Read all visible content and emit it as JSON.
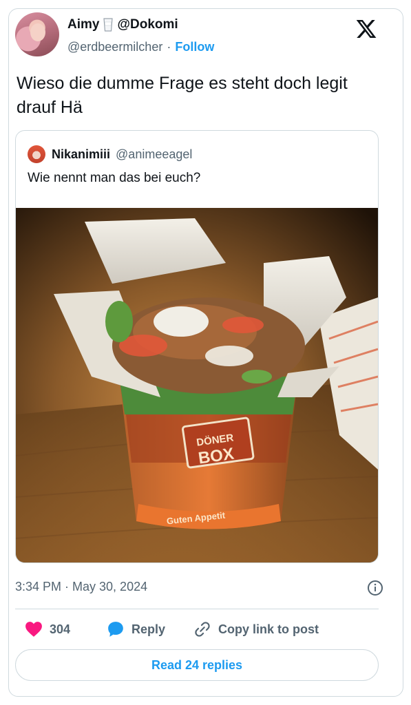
{
  "author": {
    "display_name": "Aimy",
    "name_suffix": "@Dokomi",
    "handle": "@erdbeermilcher",
    "separator": "·",
    "follow_label": "Follow"
  },
  "tweet": {
    "text": "Wieso die dumme Frage es steht doch legit drauf Hä",
    "timestamp": "3:34 PM · May 30, 2024"
  },
  "quote": {
    "display_name": "Nikanimiii",
    "handle": "@animeeagel",
    "text": "Wie nennt man das bei euch?",
    "image": {
      "box_brand_line1": "DÖNER",
      "box_brand_line2": "BOX",
      "box_slogan": "Guten Appetit"
    }
  },
  "actions": {
    "like_count": "304",
    "reply_label": "Reply",
    "copy_label": "Copy link to post"
  },
  "read_replies_label": "Read 24 replies",
  "colors": {
    "accent": "#1d9bf0",
    "like": "#f91880",
    "muted": "#536471",
    "border": "#cfd9de"
  }
}
